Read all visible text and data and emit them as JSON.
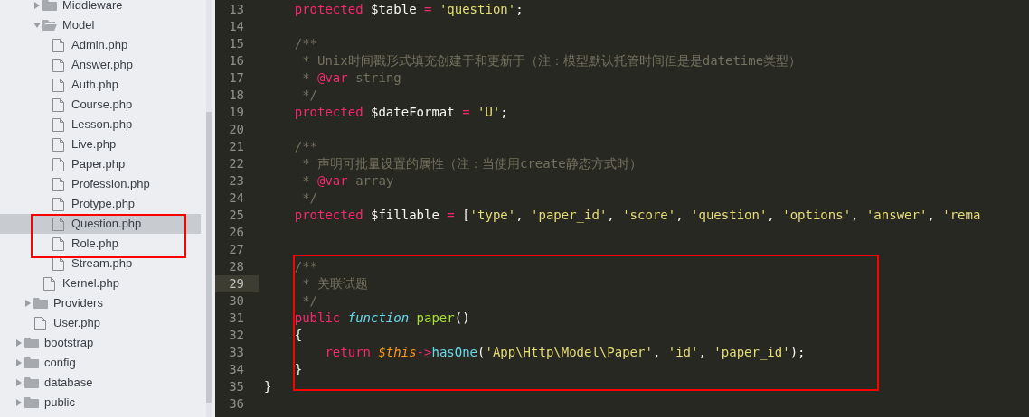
{
  "sidebar": {
    "tree": [
      {
        "children": [
          {
            "children": [
              {
                "kind": "folder",
                "name": "Middleware",
                "expanded": false,
                "selected": false
              },
              {
                "kind": "folder",
                "name": "Model",
                "expanded": true,
                "selected": false,
                "children": [
                  {
                    "kind": "file",
                    "name": "Admin.php",
                    "selected": false
                  },
                  {
                    "kind": "file",
                    "name": "Answer.php",
                    "selected": false
                  },
                  {
                    "kind": "file",
                    "name": "Auth.php",
                    "selected": false
                  },
                  {
                    "kind": "file",
                    "name": "Course.php",
                    "selected": false
                  },
                  {
                    "kind": "file",
                    "name": "Lesson.php",
                    "selected": false
                  },
                  {
                    "kind": "file",
                    "name": "Live.php",
                    "selected": false
                  },
                  {
                    "kind": "file",
                    "name": "Paper.php",
                    "selected": false
                  },
                  {
                    "kind": "file",
                    "name": "Profession.php",
                    "selected": false
                  },
                  {
                    "kind": "file",
                    "name": "Protype.php",
                    "selected": false
                  },
                  {
                    "kind": "file",
                    "name": "Question.php",
                    "selected": true
                  },
                  {
                    "kind": "file",
                    "name": "Role.php",
                    "selected": false
                  },
                  {
                    "kind": "file",
                    "name": "Stream.php",
                    "selected": false
                  }
                ]
              },
              {
                "kind": "file",
                "name": "Kernel.php",
                "selected": false
              }
            ]
          },
          {
            "kind": "folder",
            "name": "Providers",
            "expanded": false,
            "selected": false
          },
          {
            "kind": "file",
            "name": "User.php",
            "selected": false
          }
        ]
      },
      {
        "kind": "folder",
        "name": "bootstrap",
        "expanded": false,
        "selected": false
      },
      {
        "kind": "folder",
        "name": "config",
        "expanded": false,
        "selected": false
      },
      {
        "kind": "folder",
        "name": "database",
        "expanded": false,
        "selected": false
      },
      {
        "kind": "folder",
        "name": "public",
        "expanded": false,
        "selected": false
      }
    ]
  },
  "editor": {
    "lines": [
      {
        "number": "13",
        "current": false,
        "tokens": [
          {
            "kind": "keyword",
            "text": "    protected"
          },
          {
            "kind": "plain",
            "text": " $table "
          },
          {
            "kind": "keyword",
            "text": "="
          },
          {
            "kind": "string",
            "text": " 'question'"
          },
          {
            "kind": "plain",
            "text": ";"
          }
        ]
      },
      {
        "number": "14",
        "current": false
      },
      {
        "number": "15",
        "current": false,
        "tokens": [
          {
            "kind": "comment",
            "text": "    /**"
          }
        ]
      },
      {
        "number": "16",
        "current": false,
        "tokens": [
          {
            "kind": "comment",
            "text": "     * Unix时间戳形式填充创建于和更新于（注：模型默认托管时间但是是datetime类型）"
          }
        ]
      },
      {
        "number": "17",
        "current": false,
        "tokens": [
          {
            "kind": "comment",
            "text": "     * "
          },
          {
            "kind": "keyword",
            "text": "@var"
          },
          {
            "kind": "comment",
            "text": " string"
          }
        ]
      },
      {
        "number": "18",
        "current": false,
        "tokens": [
          {
            "kind": "comment",
            "text": "     */"
          }
        ]
      },
      {
        "number": "19",
        "current": false,
        "tokens": [
          {
            "kind": "keyword",
            "text": "    protected"
          },
          {
            "kind": "plain",
            "text": " $dateFormat "
          },
          {
            "kind": "keyword",
            "text": "="
          },
          {
            "kind": "string",
            "text": " 'U'"
          },
          {
            "kind": "plain",
            "text": ";"
          }
        ]
      },
      {
        "number": "20",
        "current": false
      },
      {
        "number": "21",
        "current": false,
        "tokens": [
          {
            "kind": "comment",
            "text": "    /**"
          }
        ]
      },
      {
        "number": "22",
        "current": false,
        "tokens": [
          {
            "kind": "comment",
            "text": "     * 声明可批量设置的属性（注：当使用create静态方式时）"
          }
        ]
      },
      {
        "number": "23",
        "current": false,
        "tokens": [
          {
            "kind": "comment",
            "text": "     * "
          },
          {
            "kind": "keyword",
            "text": "@var"
          },
          {
            "kind": "comment",
            "text": " array"
          }
        ]
      },
      {
        "number": "24",
        "current": false,
        "tokens": [
          {
            "kind": "comment",
            "text": "     */"
          }
        ]
      },
      {
        "number": "25",
        "current": false,
        "tokens": [
          {
            "kind": "keyword",
            "text": "    protected"
          },
          {
            "kind": "plain",
            "text": " $fillable "
          },
          {
            "kind": "keyword",
            "text": "="
          },
          {
            "kind": "plain",
            "text": " ["
          },
          {
            "kind": "string",
            "text": "'type'"
          },
          {
            "kind": "plain",
            "text": ", "
          },
          {
            "kind": "string",
            "text": "'paper_id'"
          },
          {
            "kind": "plain",
            "text": ", "
          },
          {
            "kind": "string",
            "text": "'score'"
          },
          {
            "kind": "plain",
            "text": ", "
          },
          {
            "kind": "string",
            "text": "'question'"
          },
          {
            "kind": "plain",
            "text": ", "
          },
          {
            "kind": "string",
            "text": "'options'"
          },
          {
            "kind": "plain",
            "text": ", "
          },
          {
            "kind": "string",
            "text": "'answer'"
          },
          {
            "kind": "plain",
            "text": ", "
          },
          {
            "kind": "string",
            "text": "'rema"
          }
        ]
      },
      {
        "number": "26",
        "current": false
      },
      {
        "number": "27",
        "current": false
      },
      {
        "number": "28",
        "current": false,
        "tokens": [
          {
            "kind": "comment",
            "text": "    /**"
          }
        ]
      },
      {
        "number": "29",
        "current": true,
        "tokens": [
          {
            "kind": "comment",
            "text": "     * 关联试题"
          }
        ]
      },
      {
        "number": "30",
        "current": false,
        "tokens": [
          {
            "kind": "comment",
            "text": "     */"
          }
        ]
      },
      {
        "number": "31",
        "current": false,
        "tokens": [
          {
            "kind": "keyword",
            "text": "    public"
          },
          {
            "kind": "storage",
            "text": " function"
          },
          {
            "kind": "function",
            "text": " paper"
          },
          {
            "kind": "plain",
            "text": "()"
          }
        ]
      },
      {
        "number": "32",
        "current": false,
        "tokens": [
          {
            "kind": "plain",
            "text": "    {"
          }
        ]
      },
      {
        "number": "33",
        "current": false,
        "tokens": [
          {
            "kind": "keyword",
            "text": "        return"
          },
          {
            "kind": "variable",
            "text": " $this"
          },
          {
            "kind": "keyword",
            "text": "->"
          },
          {
            "kind": "support",
            "text": "hasOne"
          },
          {
            "kind": "plain",
            "text": "("
          },
          {
            "kind": "string",
            "text": "'App\\Http\\Model\\Paper'"
          },
          {
            "kind": "plain",
            "text": ", "
          },
          {
            "kind": "string",
            "text": "'id'"
          },
          {
            "kind": "plain",
            "text": ", "
          },
          {
            "kind": "string",
            "text": "'paper_id'"
          },
          {
            "kind": "plain",
            "text": ");"
          }
        ]
      },
      {
        "number": "34",
        "current": false,
        "tokens": [
          {
            "kind": "plain",
            "text": "    }"
          }
        ]
      },
      {
        "number": "35",
        "current": false,
        "tokens": [
          {
            "kind": "plain",
            "text": "}"
          }
        ]
      },
      {
        "number": "36",
        "current": false
      }
    ]
  }
}
